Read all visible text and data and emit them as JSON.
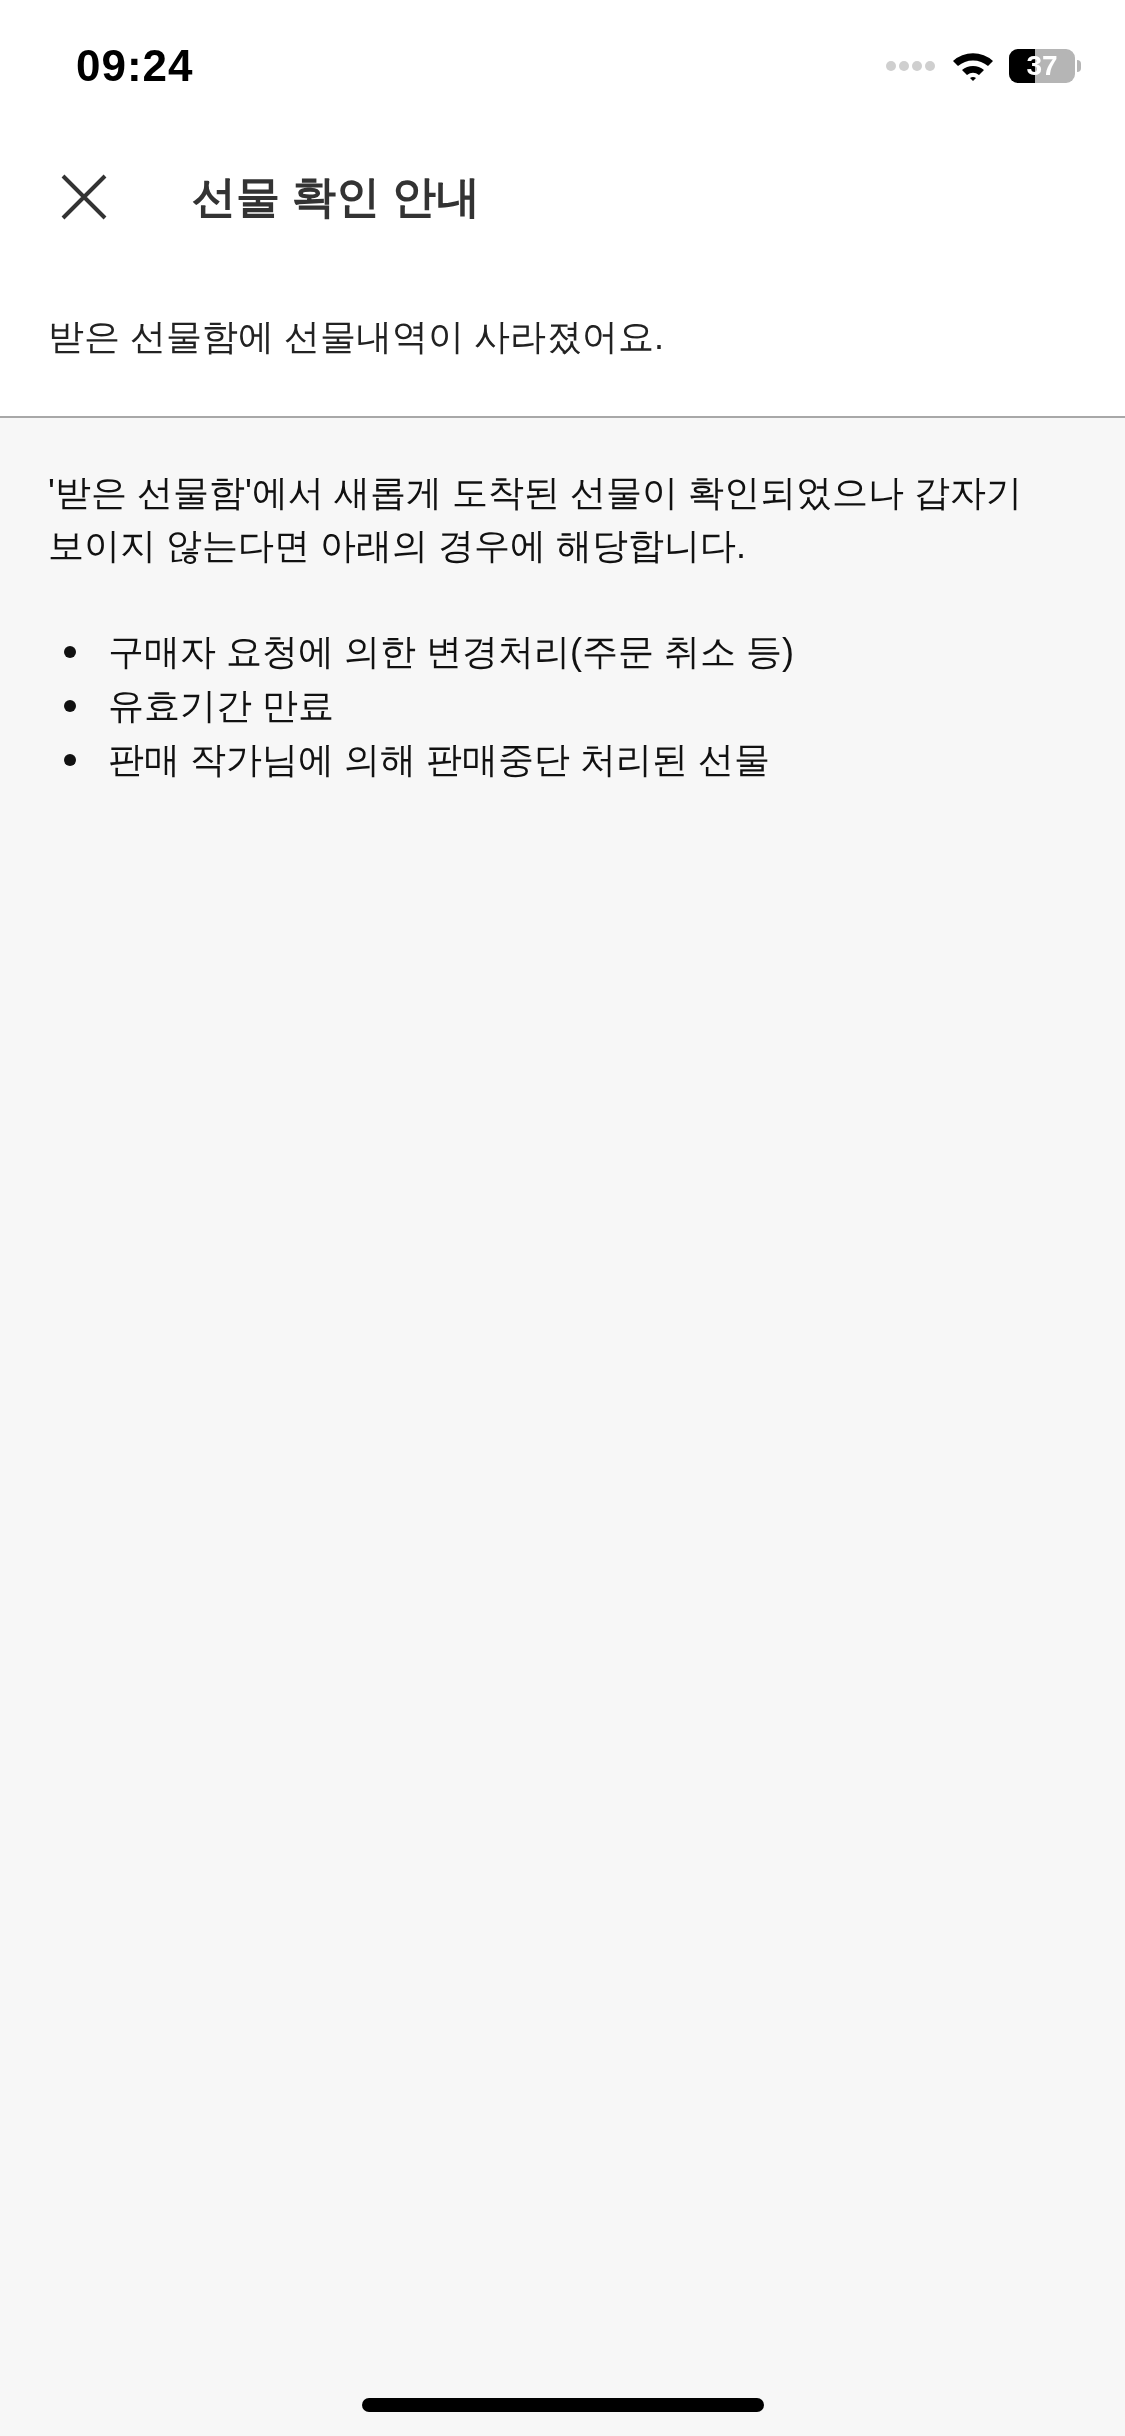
{
  "status_bar": {
    "time": "09:24",
    "battery": "37"
  },
  "header": {
    "title": "선물 확인 안내"
  },
  "subtitle": "받은 선물함에 선물내역이 사라졌어요.",
  "content": {
    "paragraph": "'받은 선물함'에서 새롭게 도착된 선물이 확인되었으나 갑자기 보이지 않는다면 아래의 경우에 해당합니다.",
    "items": [
      "구매자 요청에 의한 변경처리(주문 취소 등)",
      "유효기간 만료",
      "판매 작가님에 의해 판매중단 처리된 선물"
    ]
  }
}
